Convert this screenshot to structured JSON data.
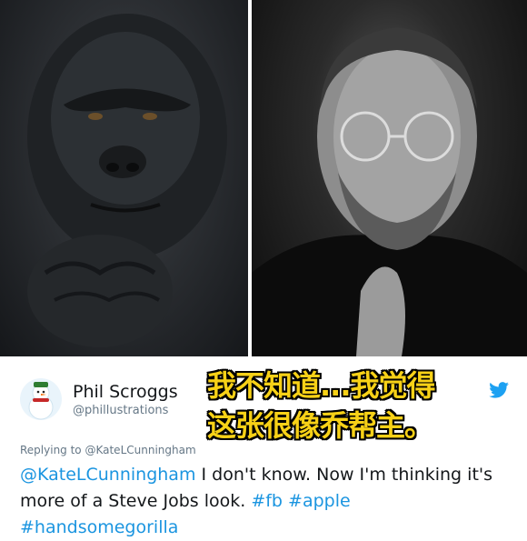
{
  "tweet": {
    "author_name": "Phil Scroggs",
    "author_handle": "@phillustrations",
    "reply_prefix": "Replying to ",
    "reply_to": "@KateLCunningham",
    "mention": "@KateLCunningham",
    "text_part1": " I don't know. Now I'm thinking it's more of a Steve Jobs look. ",
    "hashtag1": "#fb",
    "space": " ",
    "hashtag2": "#apple",
    "hashtag3": "#handsomegorilla"
  },
  "overlay_caption": {
    "line1": "我不知道...我觉得",
    "line2": "这张很像乔帮主。"
  },
  "colors": {
    "link": "#1b95e0",
    "caption_fill": "#f7d117",
    "twitter_blue": "#1da1f2"
  },
  "icons": {
    "bird": "twitter-bird-icon",
    "avatar": "snowman-avatar"
  }
}
